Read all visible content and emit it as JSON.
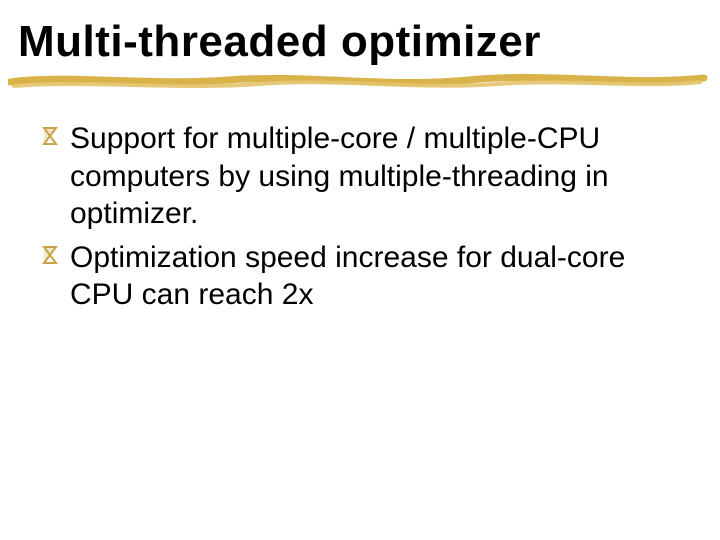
{
  "title": "Multi-threaded optimizer",
  "bullets": [
    {
      "icon": "❚",
      "text": "Support for multiple-core / multiple-CPU computers by using multiple-threading in optimizer."
    },
    {
      "icon": "❚",
      "text": "Optimization speed increase for dual-core CPU can reach 2x"
    }
  ],
  "colors": {
    "underline": "#d9b24a",
    "bullet_icon": "#c7a44a"
  }
}
